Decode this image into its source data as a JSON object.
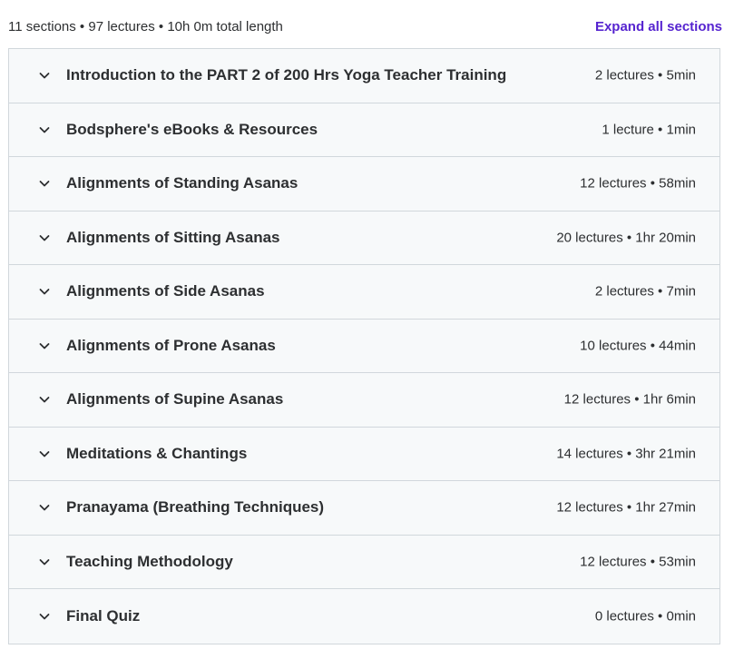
{
  "header": {
    "summary": "11 sections • 97 lectures • 10h 0m total length",
    "expand_all_label": "Expand all sections"
  },
  "colors": {
    "accent": "#5624d0",
    "row_background": "#f7f9fa",
    "border": "#d1d7dc",
    "text": "#2d2f31"
  },
  "sections": [
    {
      "title": "Introduction to the PART 2 of 200 Hrs Yoga Teacher Training",
      "meta": "2 lectures • 5min",
      "icon": "chevron-down-icon"
    },
    {
      "title": "Bodsphere's eBooks & Resources",
      "meta": "1 lecture • 1min",
      "icon": "chevron-down-icon"
    },
    {
      "title": "Alignments of Standing Asanas",
      "meta": "12 lectures • 58min",
      "icon": "chevron-down-icon"
    },
    {
      "title": "Alignments of Sitting Asanas",
      "meta": "20 lectures • 1hr 20min",
      "icon": "chevron-down-icon"
    },
    {
      "title": "Alignments of Side Asanas",
      "meta": "2 lectures • 7min",
      "icon": "chevron-down-icon"
    },
    {
      "title": "Alignments of Prone Asanas",
      "meta": "10 lectures • 44min",
      "icon": "chevron-down-icon"
    },
    {
      "title": "Alignments of Supine Asanas",
      "meta": "12 lectures • 1hr 6min",
      "icon": "chevron-down-icon"
    },
    {
      "title": "Meditations & Chantings",
      "meta": "14 lectures • 3hr 21min",
      "icon": "chevron-down-icon"
    },
    {
      "title": "Pranayama (Breathing Techniques)",
      "meta": "12 lectures • 1hr 27min",
      "icon": "chevron-down-icon"
    },
    {
      "title": "Teaching Methodology",
      "meta": "12 lectures • 53min",
      "icon": "chevron-down-icon"
    },
    {
      "title": "Final Quiz",
      "meta": "0 lectures • 0min",
      "icon": "chevron-down-icon"
    }
  ]
}
